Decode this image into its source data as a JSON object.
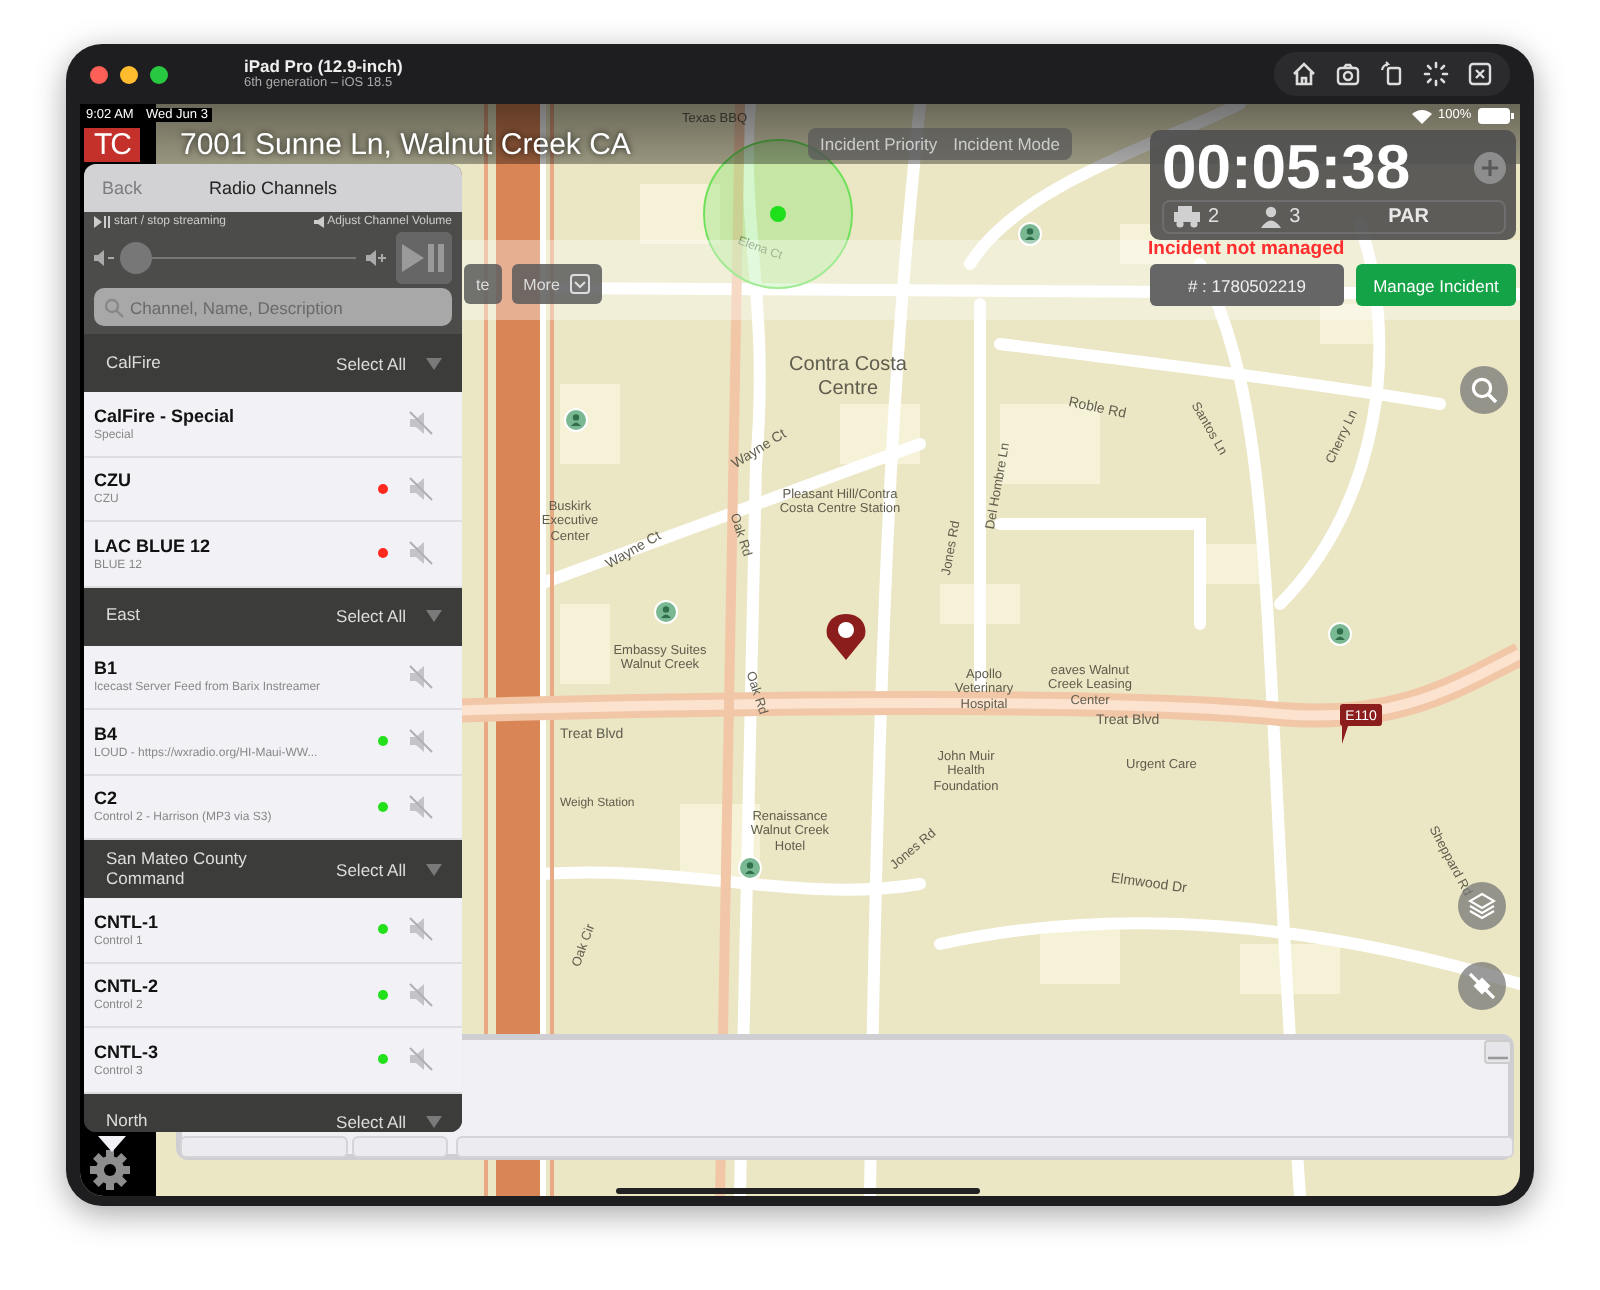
{
  "window": {
    "title": "iPad Pro (12.9-inch)",
    "subtitle": "6th generation – iOS 18.5"
  },
  "status_bar": {
    "time": "9:02 AM",
    "date": "Wed Jun 3",
    "battery": "100%"
  },
  "app": {
    "logo": "TC",
    "address": "7001 Sunne Ln, Walnut Creek CA"
  },
  "radio_panel": {
    "back": "Back",
    "title": "Radio Channels",
    "hint_stream": "start / stop streaming",
    "hint_volume": "Adjust Channel Volume",
    "volume": {
      "level": 0.05
    },
    "search": {
      "placeholder": "Channel, Name, Description"
    },
    "groups": [
      {
        "name": "CalFire",
        "select_all": "Select All",
        "channels": [
          {
            "name": "CalFire - Special",
            "description": "Special"
          },
          {
            "name": "CZU",
            "description": "CZU",
            "color": "#ff2a1f"
          },
          {
            "name": "LAC BLUE 12",
            "description": "BLUE 12",
            "color": "#ff2a1f"
          }
        ]
      },
      {
        "name": "East",
        "select_all": "Select All",
        "channels": [
          {
            "name": "B1",
            "description": "Icecast Server Feed from Barix Instreamer"
          },
          {
            "name": "B4",
            "description": "LOUD - https://wxradio.org/HI-Maui-WW...",
            "color": "#22e01a"
          },
          {
            "name": "C2",
            "description": "Control 2 - Harrison (MP3 via S3)",
            "color": "#22e01a"
          }
        ]
      },
      {
        "name": "San Mateo County Command",
        "select_all": "Select All",
        "channels": [
          {
            "name": "CNTL-1",
            "description": "Control 1",
            "color": "#22e01a"
          },
          {
            "name": "CNTL-2",
            "description": "Control 2",
            "color": "#22e01a"
          },
          {
            "name": "CNTL-3",
            "description": "Control 3",
            "color": "#22e01a"
          }
        ]
      },
      {
        "name": "North",
        "select_all": "Select All"
      }
    ]
  },
  "incident_bar": {
    "buttons": [
      "Incident Priority",
      "Incident Mode"
    ]
  },
  "toolbar": {
    "buttons": [
      "te",
      "More"
    ]
  },
  "timer": {
    "elapsed": "00:05:38",
    "vehicles": "2",
    "personnel": "3",
    "par": "PAR"
  },
  "incident_status": "Incident not managed",
  "incident_number": "# : 1780502219",
  "manage_button": "Manage Incident",
  "map": {
    "unit_badge": "E110",
    "labels": [
      "Texas BBQ",
      "Elena Ct",
      "Contra Costa Centre",
      "Roble Rd",
      "Santos Ln",
      "Cherry Ln",
      "Wayne Ct",
      "Wayne Ct",
      "Buskirk Executive Center",
      "Pleasant Hill/Contra Costa Centre Station",
      "Oak Rd",
      "Oak Rd",
      "Del Hombre Ln",
      "Jones Rd",
      "Embassy Suites Walnut Creek",
      "Apollo Veterinary Hospital",
      "eaves Walnut Creek Leasing Center",
      "Treat Blvd",
      "Treat Blvd",
      "John Muir Health Foundation",
      "Urgent Care",
      "Renaissance Walnut Creek Hotel",
      "Elmwood Dr",
      "Jones Rd",
      "Oak Cir",
      "Sheppard Rd",
      "Weigh Station"
    ]
  }
}
